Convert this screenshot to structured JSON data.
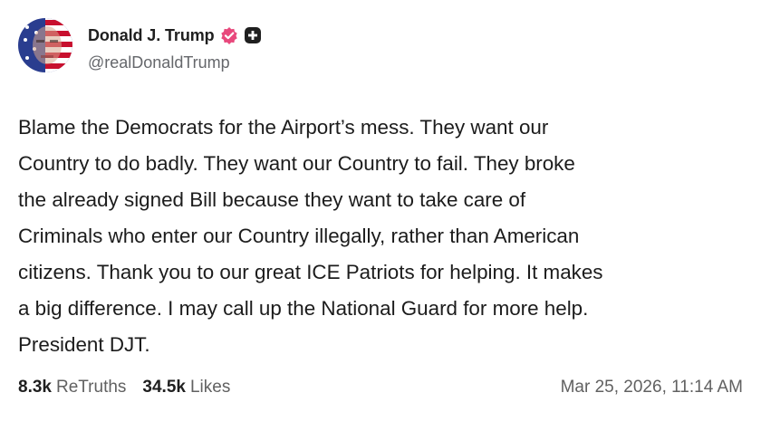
{
  "author": {
    "display_name": "Donald J. Trump",
    "handle": "@realDonaldTrump",
    "avatar_icon": "flag-portrait-avatar",
    "verified_icon": "verified-badge-icon",
    "verified_color": "#e8487c",
    "plus_icon": "plus-badge-icon"
  },
  "post": {
    "text": "Blame the Democrats for the Airport’s mess. They want our\nCountry to do badly. They want our Country to fail. They broke\nthe already signed Bill because they want to take care of\nCriminals who enter our Country illegally, rather than American\ncitizens. Thank you to our great ICE Patriots for helping. It makes\na big difference. I may call up the National Guard for more help.\nPresident DJT."
  },
  "stats": {
    "retruths_count": "8.3k",
    "retruths_label": "ReTruths",
    "likes_count": "34.5k",
    "likes_label": "Likes"
  },
  "timestamp": "Mar 25, 2026, 11:14 AM"
}
